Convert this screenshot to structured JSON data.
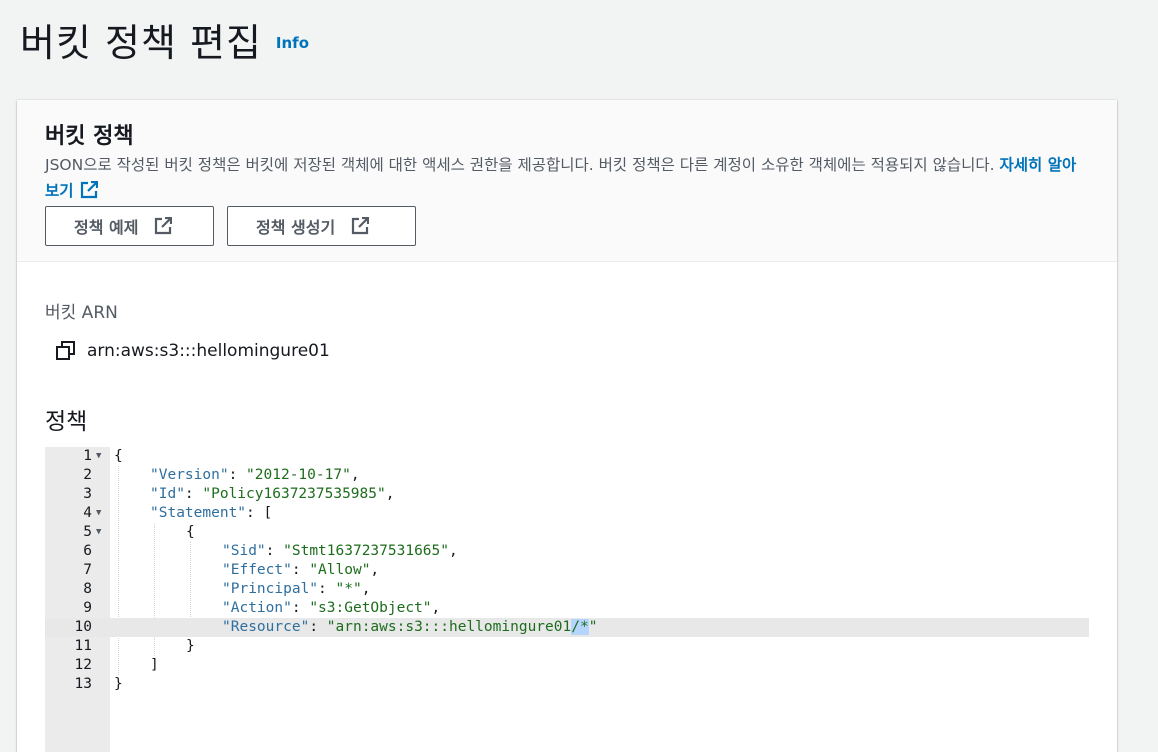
{
  "header": {
    "title": "버킷 정책 편집",
    "info_link": "Info"
  },
  "panel": {
    "title": "버킷 정책",
    "description": "JSON으로 작성된 버킷 정책은 버킷에 저장된 객체에 대한 액세스 권한을 제공합니다. 버킷 정책은 다른 계정이 소유한 객체에는 적용되지 않습니다.",
    "learn_more": "자세히 알아보기",
    "buttons": {
      "policy_examples": "정책 예제",
      "policy_generator": "정책 생성기"
    }
  },
  "arn": {
    "label": "버킷 ARN",
    "value": "arn:aws:s3:::hellomingure01"
  },
  "policy": {
    "label": "정책"
  },
  "editor": {
    "line_numbers": [
      "1",
      "2",
      "3",
      "4",
      "5",
      "6",
      "7",
      "8",
      "9",
      "10",
      "11",
      "12",
      "13"
    ],
    "tokens": {
      "l1_open": "{",
      "version_key": "\"Version\"",
      "version_val": "\"2012-10-17\"",
      "id_key": "\"Id\"",
      "id_val": "\"Policy1637237535985\"",
      "statement_key": "\"Statement\"",
      "bracket_open": "[",
      "obj_open": "{",
      "sid_key": "\"Sid\"",
      "sid_val": "\"Stmt1637237531665\"",
      "effect_key": "\"Effect\"",
      "effect_val": "\"Allow\"",
      "principal_key": "\"Principal\"",
      "principal_val": "\"*\"",
      "action_key": "\"Action\"",
      "action_val": "\"s3:GetObject\"",
      "resource_key": "\"Resource\"",
      "resource_val_a": "\"arn:aws:s3:::hellomingure01",
      "resource_val_sel": "/*",
      "resource_val_b": "\"",
      "obj_close": "}",
      "bracket_close": "]",
      "root_close": "}"
    },
    "active_line": 10
  },
  "colors": {
    "link": "#0073bb",
    "json_key": "#2e6f9e",
    "json_string": "#1d6d1d",
    "selection": "#b5d5ff"
  }
}
